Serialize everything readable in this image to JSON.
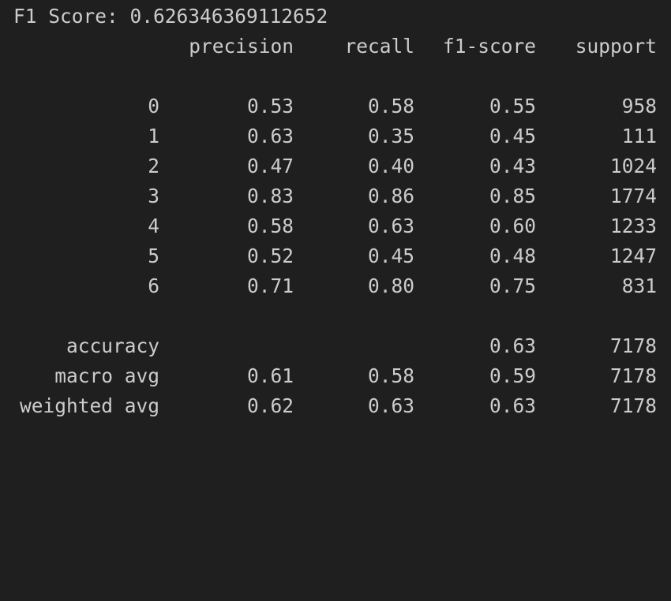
{
  "output": {
    "f1_label": "F1 Score:",
    "f1_value": "0.626346369112652",
    "headers": {
      "precision": "precision",
      "recall": "recall",
      "f1_score": "f1-score",
      "support": "support"
    },
    "rows": [
      {
        "label": "0",
        "precision": "0.53",
        "recall": "0.58",
        "f1_score": "0.55",
        "support": "958"
      },
      {
        "label": "1",
        "precision": "0.63",
        "recall": "0.35",
        "f1_score": "0.45",
        "support": "111"
      },
      {
        "label": "2",
        "precision": "0.47",
        "recall": "0.40",
        "f1_score": "0.43",
        "support": "1024"
      },
      {
        "label": "3",
        "precision": "0.83",
        "recall": "0.86",
        "f1_score": "0.85",
        "support": "1774"
      },
      {
        "label": "4",
        "precision": "0.58",
        "recall": "0.63",
        "f1_score": "0.60",
        "support": "1233"
      },
      {
        "label": "5",
        "precision": "0.52",
        "recall": "0.45",
        "f1_score": "0.48",
        "support": "1247"
      },
      {
        "label": "6",
        "precision": "0.71",
        "recall": "0.80",
        "f1_score": "0.75",
        "support": "831"
      }
    ],
    "summary": [
      {
        "label": "accuracy",
        "precision": "",
        "recall": "",
        "f1_score": "0.63",
        "support": "7178"
      },
      {
        "label": "macro avg",
        "precision": "0.61",
        "recall": "0.58",
        "f1_score": "0.59",
        "support": "7178"
      },
      {
        "label": "weighted avg",
        "precision": "0.62",
        "recall": "0.63",
        "f1_score": "0.63",
        "support": "7178"
      }
    ]
  },
  "colors": {
    "background": "#1f1f1f",
    "text": "#cccccc"
  }
}
